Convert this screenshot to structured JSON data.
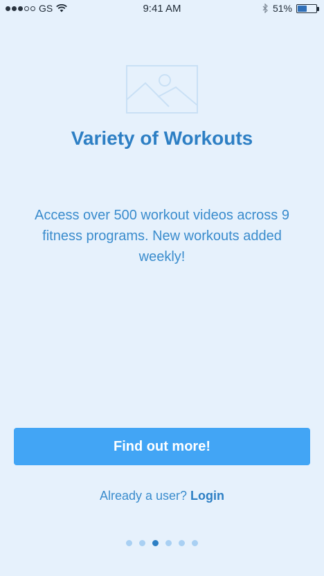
{
  "status_bar": {
    "carrier": "GS",
    "time": "9:41 AM",
    "battery_percent_label": "51%",
    "battery_level": 0.51,
    "signal_bars_filled": 3,
    "signal_bars_total": 5
  },
  "hero": {
    "image_icon": "image-placeholder-icon"
  },
  "onboarding": {
    "title": "Variety of Workouts",
    "description": "Access over 500 workout videos across 9 fitness programs. New workouts added weekly!"
  },
  "cta": {
    "label": "Find out more!"
  },
  "login": {
    "prompt": "Already a user?",
    "link_label": "Login"
  },
  "pager": {
    "total": 6,
    "active_index": 2
  },
  "colors": {
    "background": "#e6f1fc",
    "accent": "#2d7fc4",
    "button": "#42a5f5"
  }
}
